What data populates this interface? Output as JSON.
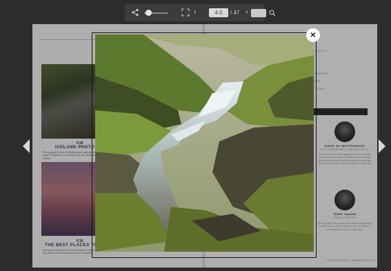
{
  "toolbar": {
    "page_indicator": "4-5",
    "page_total": "/ 47",
    "icons": [
      "share-icon",
      "zoom-slider",
      "fullscreen-icon",
      "chevron-left-icon",
      "chevron-right-icon",
      "search-icon"
    ]
  },
  "left_page": {
    "article1": {
      "page_num": "P.35",
      "title": "ICELAND PHOTO JOU",
      "caption": "Photographer Einar Óli Matthíasson captured the rugged highlands on a trip through the Icelandic interior."
    },
    "article2": {
      "page_num": "P.36",
      "title": "THE BEST PLACES TO TRAV",
      "caption": "Plan your adventure to the best places to travel this season, and the places to visit next year."
    }
  },
  "right_page": {
    "menu": [
      "ODUCTS",
      "",
      "E",
      "K",
      "",
      "UPMENTS",
      "NCH",
      "CTIONS"
    ],
    "person1": {
      "name": "EINAR ÓLI MATTHÍASSON",
      "role": "PHOTOGRAPHER & ICELAND GUIDE",
      "bio": "Einar worked as a photographer for over a decade before becoming a guide in Iceland. He now spends his time leading small groups through the highlands, sharing stories of the rugged landscape he captures."
    },
    "person2": {
      "name": "TERRI JANSEN",
      "role": "TRAVEL WRITER",
      "bio": "Terri is a Cape Town-based writer with a particular love for quiet places, whether beside a river, a canyon, or the windswept coast she calls home."
    },
    "footer": "THE EXPLORER | WINTER EDITION"
  },
  "lightbox": {
    "close_label": "×",
    "image_subject": "Highland river canyon with waterfall and green moss"
  },
  "colors": {
    "background": "#2c2c2c",
    "toolbar": "#3c3c3c",
    "title_blue": "#2f3b5e"
  }
}
